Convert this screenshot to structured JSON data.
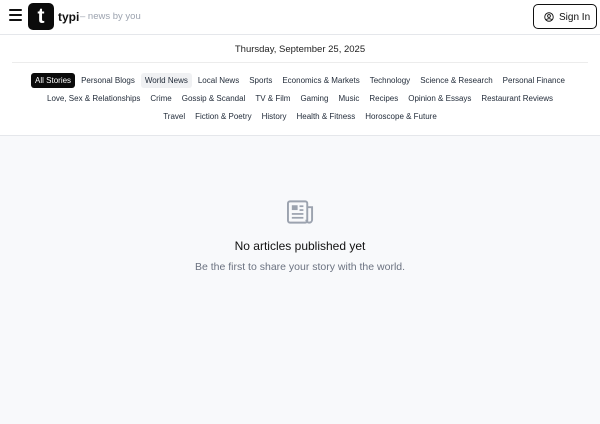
{
  "header": {
    "brand": "typi",
    "tagline": "– news by you",
    "logo_letter": "t",
    "signin_label": "Sign In"
  },
  "date": "Thursday, September 25, 2025",
  "categories": [
    {
      "label": "All Stories",
      "state": "active"
    },
    {
      "label": "Personal Blogs",
      "state": ""
    },
    {
      "label": "World News",
      "state": "hover"
    },
    {
      "label": "Local News",
      "state": ""
    },
    {
      "label": "Sports",
      "state": ""
    },
    {
      "label": "Economics & Markets",
      "state": ""
    },
    {
      "label": "Technology",
      "state": ""
    },
    {
      "label": "Science & Research",
      "state": ""
    },
    {
      "label": "Personal Finance",
      "state": ""
    },
    {
      "label": "Love, Sex & Relationships",
      "state": ""
    },
    {
      "label": "Crime",
      "state": ""
    },
    {
      "label": "Gossip & Scandal",
      "state": ""
    },
    {
      "label": "TV & Film",
      "state": ""
    },
    {
      "label": "Gaming",
      "state": ""
    },
    {
      "label": "Music",
      "state": ""
    },
    {
      "label": "Recipes",
      "state": ""
    },
    {
      "label": "Opinion & Essays",
      "state": ""
    },
    {
      "label": "Restaurant Reviews",
      "state": ""
    },
    {
      "label": "Travel",
      "state": ""
    },
    {
      "label": "Fiction & Poetry",
      "state": ""
    },
    {
      "label": "History",
      "state": ""
    },
    {
      "label": "Health & Fitness",
      "state": ""
    },
    {
      "label": "Horoscope & Future",
      "state": ""
    }
  ],
  "empty_state": {
    "icon": "newspaper-icon",
    "title": "No articles published yet",
    "subtitle": "Be the first to share your story with the world."
  },
  "colors": {
    "accent": "#0b0b0b",
    "background": "#f8f9fb",
    "muted": "#6b7280"
  }
}
